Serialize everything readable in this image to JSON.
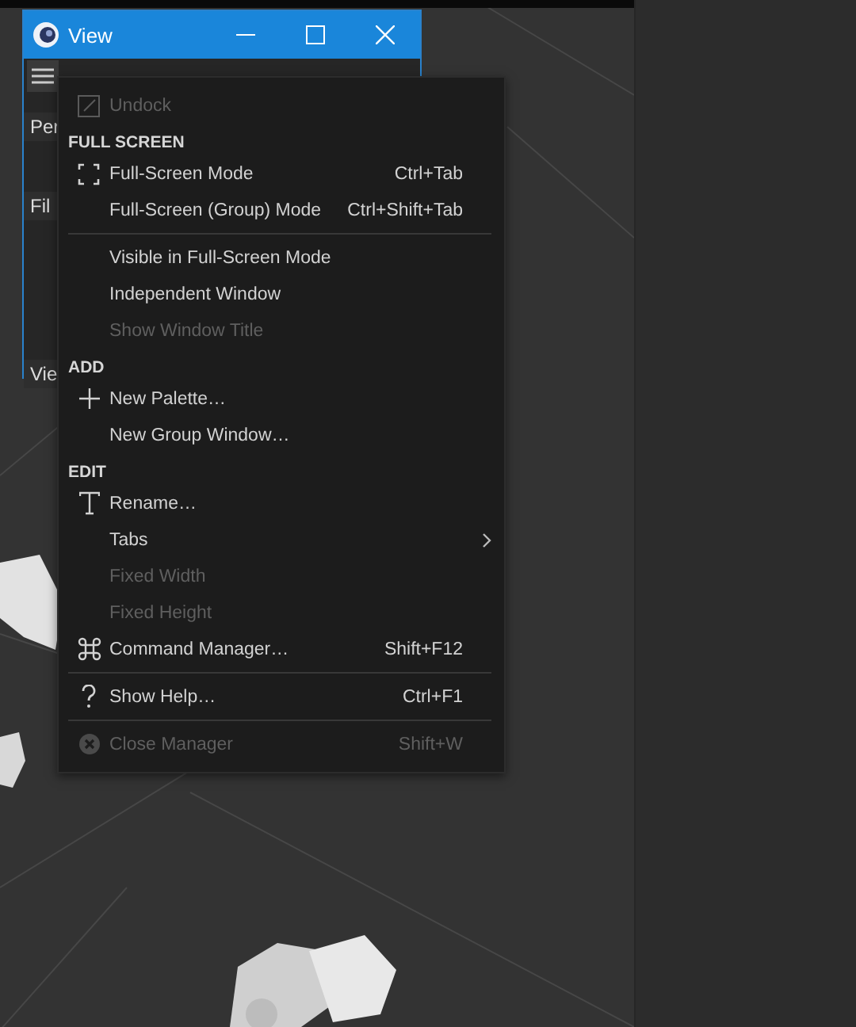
{
  "window": {
    "title": "View"
  },
  "side_labels": [
    "Per",
    "Fil",
    "Vie"
  ],
  "menu": [
    {
      "kind": "item",
      "label": "Undock",
      "disabled": true,
      "submenu": false
    },
    {
      "kind": "header",
      "label": "FULL SCREEN"
    },
    {
      "kind": "item",
      "label": "Full-Screen Mode",
      "shortcut": "Ctrl+Tab",
      "disabled": false,
      "submenu": false
    },
    {
      "kind": "item",
      "label": "Full-Screen (Group) Mode",
      "shortcut": "Ctrl+Shift+Tab",
      "disabled": false,
      "submenu": false
    },
    {
      "kind": "separator"
    },
    {
      "kind": "item",
      "label": "Visible in Full-Screen Mode",
      "disabled": false,
      "submenu": false
    },
    {
      "kind": "item",
      "label": "Independent Window",
      "disabled": false,
      "submenu": false
    },
    {
      "kind": "item",
      "label": "Show Window Title",
      "disabled": true,
      "submenu": false
    },
    {
      "kind": "header",
      "label": "ADD"
    },
    {
      "kind": "item",
      "label": "New Palette…",
      "disabled": false,
      "submenu": false
    },
    {
      "kind": "item",
      "label": "New Group Window…",
      "disabled": false,
      "submenu": false
    },
    {
      "kind": "header",
      "label": "EDIT"
    },
    {
      "kind": "item",
      "label": "Rename…",
      "disabled": false,
      "submenu": false
    },
    {
      "kind": "item",
      "label": "Tabs",
      "disabled": false,
      "submenu": true
    },
    {
      "kind": "item",
      "label": "Fixed Width",
      "disabled": true,
      "submenu": false
    },
    {
      "kind": "item",
      "label": "Fixed Height",
      "disabled": true,
      "submenu": false
    },
    {
      "kind": "item",
      "label": "Command Manager…",
      "shortcut": "Shift+F12",
      "disabled": false,
      "submenu": false
    },
    {
      "kind": "separator"
    },
    {
      "kind": "item",
      "label": "Show Help…",
      "shortcut": "Ctrl+F1",
      "disabled": false,
      "submenu": false
    },
    {
      "kind": "separator"
    },
    {
      "kind": "item",
      "label": "Close Manager",
      "shortcut": "Shift+W",
      "disabled": true,
      "submenu": false
    }
  ]
}
